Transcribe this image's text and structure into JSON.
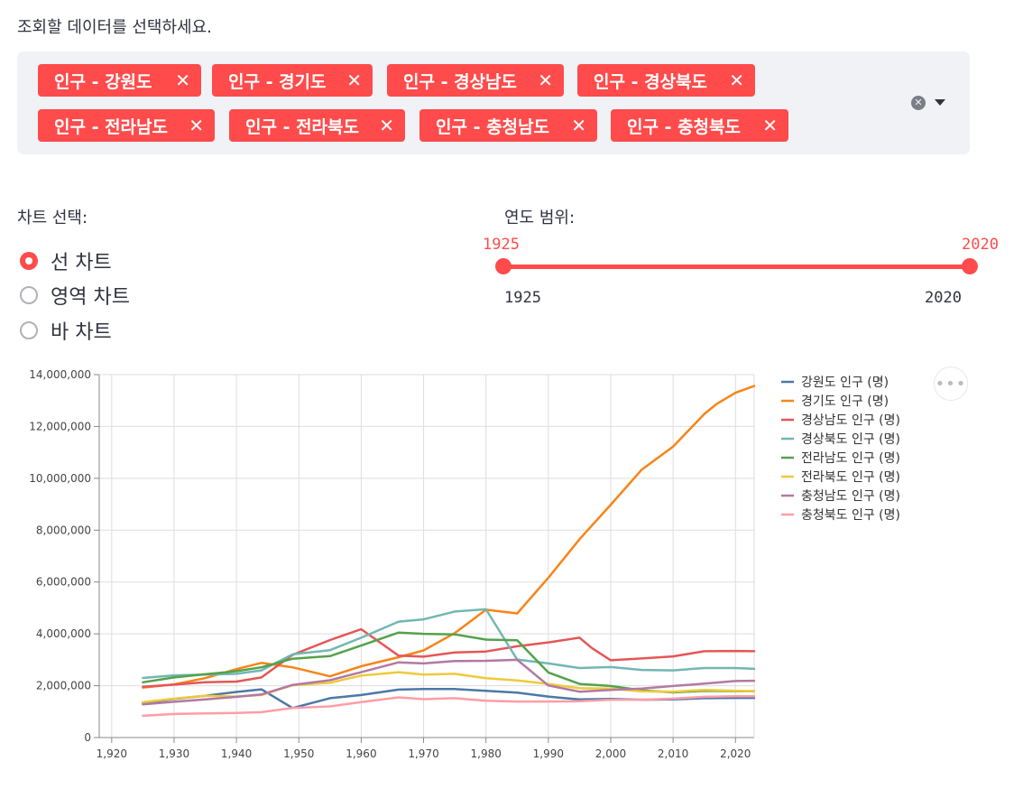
{
  "prompt": "조회할 데이터를 선택하세요.",
  "tags": [
    "인구 - 강원도",
    "인구 - 경기도",
    "인구 - 경상남도",
    "인구 - 경상북도",
    "인구 - 전라남도",
    "인구 - 전라북도",
    "인구 - 충청남도",
    "인구 - 충청북도"
  ],
  "tag_remove_glyph": "✕",
  "clear_glyph": "✕",
  "chart_select": {
    "label": "차트 선택:",
    "options": [
      "선 차트",
      "영역 차트",
      "바 차트"
    ],
    "selected": 0
  },
  "year_range": {
    "label": "연도 범위:",
    "min": 1925,
    "max": 2020,
    "low": 1925,
    "high": 2020
  },
  "menu_glyph": "•••",
  "colors": {
    "accent": "#ff4b4b"
  },
  "chart_data": {
    "type": "line",
    "xlim": [
      1918,
      2023
    ],
    "ylim": [
      0,
      14000000
    ],
    "xticks": [
      1920,
      1930,
      1940,
      1950,
      1960,
      1970,
      1980,
      1990,
      2000,
      2010,
      2020
    ],
    "xtick_labels": [
      "1,920",
      "1,930",
      "1,940",
      "1,950",
      "1,960",
      "1,970",
      "1,980",
      "1,990",
      "2,000",
      "2,010",
      "2,020"
    ],
    "yticks": [
      0,
      2000000,
      4000000,
      6000000,
      8000000,
      10000000,
      12000000,
      14000000
    ],
    "ytick_labels": [
      "0",
      "2,000,000",
      "4,000,000",
      "6,000,000",
      "8,000,000",
      "10,000,000",
      "12,000,000",
      "14,000,000"
    ],
    "grid": true,
    "legend": "right",
    "series": [
      {
        "name": "강원도 인구 (명)",
        "color": "#4c78a8",
        "points": [
          [
            1925,
            1330000
          ],
          [
            1930,
            1490000
          ],
          [
            1935,
            1610000
          ],
          [
            1940,
            1760000
          ],
          [
            1944,
            1860000
          ],
          [
            1949,
            1140000
          ],
          [
            1955,
            1520000
          ],
          [
            1960,
            1640000
          ],
          [
            1966,
            1850000
          ],
          [
            1970,
            1870000
          ],
          [
            1975,
            1870000
          ],
          [
            1980,
            1800000
          ],
          [
            1985,
            1730000
          ],
          [
            1990,
            1580000
          ],
          [
            1995,
            1470000
          ],
          [
            2000,
            1490000
          ],
          [
            2005,
            1460000
          ],
          [
            2010,
            1470000
          ],
          [
            2015,
            1520000
          ],
          [
            2020,
            1530000
          ],
          [
            2023,
            1530000
          ]
        ]
      },
      {
        "name": "경기도 인구 (명)",
        "color": "#f58518",
        "points": [
          [
            1925,
            1930000
          ],
          [
            1930,
            2050000
          ],
          [
            1935,
            2290000
          ],
          [
            1940,
            2640000
          ],
          [
            1944,
            2880000
          ],
          [
            1949,
            2710000
          ],
          [
            1955,
            2360000
          ],
          [
            1960,
            2750000
          ],
          [
            1966,
            3100000
          ],
          [
            1970,
            3360000
          ],
          [
            1975,
            4030000
          ],
          [
            1980,
            4930000
          ],
          [
            1985,
            4790000
          ],
          [
            1990,
            6160000
          ],
          [
            1995,
            7650000
          ],
          [
            2000,
            8980000
          ],
          [
            2005,
            10340000
          ],
          [
            2010,
            11220000
          ],
          [
            2015,
            12480000
          ],
          [
            2017,
            12870000
          ],
          [
            2020,
            13300000
          ],
          [
            2023,
            13560000
          ]
        ]
      },
      {
        "name": "경상남도 인구 (명)",
        "color": "#e45756",
        "points": [
          [
            1925,
            1960000
          ],
          [
            1930,
            2040000
          ],
          [
            1935,
            2130000
          ],
          [
            1940,
            2160000
          ],
          [
            1944,
            2320000
          ],
          [
            1949,
            3190000
          ],
          [
            1955,
            3760000
          ],
          [
            1960,
            4180000
          ],
          [
            1966,
            3160000
          ],
          [
            1970,
            3120000
          ],
          [
            1975,
            3280000
          ],
          [
            1980,
            3320000
          ],
          [
            1985,
            3520000
          ],
          [
            1990,
            3670000
          ],
          [
            1995,
            3850000
          ],
          [
            1997,
            3450000
          ],
          [
            2000,
            2980000
          ],
          [
            2005,
            3050000
          ],
          [
            2010,
            3130000
          ],
          [
            2015,
            3330000
          ],
          [
            2020,
            3340000
          ],
          [
            2023,
            3330000
          ]
        ]
      },
      {
        "name": "경상북도 인구 (명)",
        "color": "#72b7b2",
        "points": [
          [
            1925,
            2300000
          ],
          [
            1930,
            2400000
          ],
          [
            1935,
            2430000
          ],
          [
            1940,
            2460000
          ],
          [
            1944,
            2590000
          ],
          [
            1949,
            3210000
          ],
          [
            1955,
            3370000
          ],
          [
            1960,
            3850000
          ],
          [
            1966,
            4470000
          ],
          [
            1970,
            4560000
          ],
          [
            1975,
            4860000
          ],
          [
            1980,
            4950000
          ],
          [
            1985,
            3010000
          ],
          [
            1990,
            2860000
          ],
          [
            1995,
            2680000
          ],
          [
            2000,
            2720000
          ],
          [
            2005,
            2610000
          ],
          [
            2010,
            2590000
          ],
          [
            2015,
            2680000
          ],
          [
            2020,
            2680000
          ],
          [
            2023,
            2650000
          ]
        ]
      },
      {
        "name": "전라남도 인구 (명)",
        "color": "#54a24b",
        "points": [
          [
            1925,
            2130000
          ],
          [
            1930,
            2320000
          ],
          [
            1935,
            2440000
          ],
          [
            1940,
            2560000
          ],
          [
            1944,
            2710000
          ],
          [
            1949,
            3040000
          ],
          [
            1955,
            3140000
          ],
          [
            1960,
            3550000
          ],
          [
            1966,
            4050000
          ],
          [
            1970,
            4000000
          ],
          [
            1975,
            3980000
          ],
          [
            1980,
            3780000
          ],
          [
            1985,
            3750000
          ],
          [
            1990,
            2510000
          ],
          [
            1995,
            2070000
          ],
          [
            2000,
            1990000
          ],
          [
            2005,
            1820000
          ],
          [
            2010,
            1740000
          ],
          [
            2015,
            1800000
          ],
          [
            2020,
            1790000
          ],
          [
            2023,
            1790000
          ]
        ]
      },
      {
        "name": "전라북도 인구 (명)",
        "color": "#eeca3b",
        "points": [
          [
            1925,
            1370000
          ],
          [
            1930,
            1500000
          ],
          [
            1935,
            1610000
          ],
          [
            1940,
            1580000
          ],
          [
            1944,
            1640000
          ],
          [
            1949,
            2020000
          ],
          [
            1955,
            2110000
          ],
          [
            1960,
            2390000
          ],
          [
            1966,
            2520000
          ],
          [
            1970,
            2430000
          ],
          [
            1975,
            2460000
          ],
          [
            1980,
            2290000
          ],
          [
            1985,
            2200000
          ],
          [
            1990,
            2070000
          ],
          [
            1995,
            1900000
          ],
          [
            2000,
            1890000
          ],
          [
            2005,
            1780000
          ],
          [
            2010,
            1770000
          ],
          [
            2015,
            1840000
          ],
          [
            2020,
            1800000
          ],
          [
            2023,
            1790000
          ]
        ]
      },
      {
        "name": "충청남도 인구 (명)",
        "color": "#b279a2",
        "points": [
          [
            1925,
            1280000
          ],
          [
            1930,
            1380000
          ],
          [
            1935,
            1470000
          ],
          [
            1940,
            1570000
          ],
          [
            1944,
            1660000
          ],
          [
            1949,
            2030000
          ],
          [
            1955,
            2210000
          ],
          [
            1960,
            2520000
          ],
          [
            1966,
            2900000
          ],
          [
            1970,
            2860000
          ],
          [
            1975,
            2950000
          ],
          [
            1980,
            2960000
          ],
          [
            1985,
            3000000
          ],
          [
            1990,
            2010000
          ],
          [
            1995,
            1770000
          ],
          [
            2000,
            1840000
          ],
          [
            2005,
            1890000
          ],
          [
            2010,
            1990000
          ],
          [
            2015,
            2080000
          ],
          [
            2020,
            2180000
          ],
          [
            2023,
            2190000
          ]
        ]
      },
      {
        "name": "충청북도 인구 (명)",
        "color": "#ff9da6",
        "points": [
          [
            1925,
            840000
          ],
          [
            1930,
            910000
          ],
          [
            1935,
            930000
          ],
          [
            1940,
            950000
          ],
          [
            1944,
            980000
          ],
          [
            1949,
            1140000
          ],
          [
            1955,
            1200000
          ],
          [
            1960,
            1370000
          ],
          [
            1966,
            1550000
          ],
          [
            1970,
            1480000
          ],
          [
            1975,
            1520000
          ],
          [
            1980,
            1420000
          ],
          [
            1985,
            1390000
          ],
          [
            1990,
            1390000
          ],
          [
            1995,
            1400000
          ],
          [
            2000,
            1460000
          ],
          [
            2005,
            1460000
          ],
          [
            2010,
            1500000
          ],
          [
            2015,
            1570000
          ],
          [
            2020,
            1590000
          ],
          [
            2023,
            1590000
          ]
        ]
      }
    ]
  }
}
